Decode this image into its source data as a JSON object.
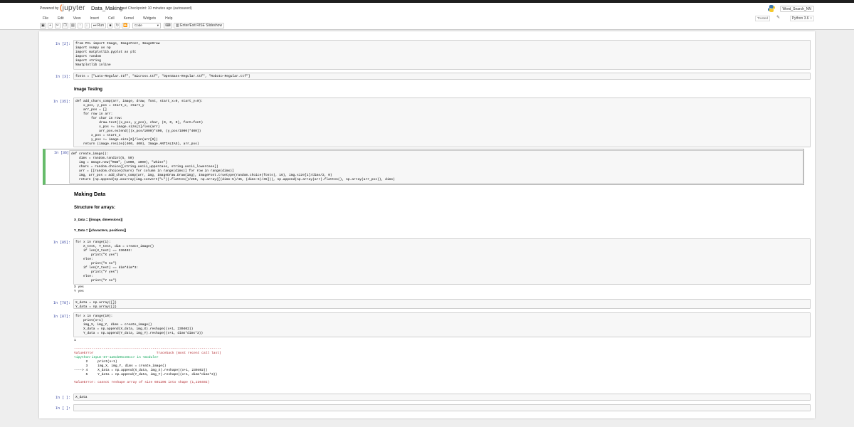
{
  "header": {
    "powered_by": "Powered by",
    "logo_text": "jupyter",
    "notebook_name": "Data_Making",
    "checkpoint": "Last Checkpoint: 10 minutes ago  (autosaved)",
    "user_button": "Word_Search_NN",
    "trusted": "Trusted",
    "kernel": "Python 3.6",
    "menu": [
      "File",
      "Edit",
      "View",
      "Insert",
      "Cell",
      "Kernel",
      "Widgets",
      "Help"
    ],
    "toolbar": {
      "save_icon": "floppy-disk-icon",
      "run_label": "Run",
      "cell_type": "Code",
      "rise_label": "Enter/Exit RISE Slideshow"
    }
  },
  "cells": {
    "c1": {
      "prompt": "In [2]:",
      "code": "from PIL import Image, ImageFont, ImageDraw\nimport numpy as np\nimport matplotlib.pyplot as plt\nimport random\nimport string\n%matplotlib inline"
    },
    "c2": {
      "prompt": "In [3]:",
      "code": "fonts = [\"Lato-Regular.ttf\", \"micross.ttf\", \"OpenSans-Regular.ttf\", \"Roboto-Regular.ttf\"]"
    },
    "md1": "Image Testing",
    "c3": {
      "prompt": "In [35]:",
      "code": "def add_chars_comp(arr, image, draw, font, start_x=0, start_y=0):\n    x_pos, y_pos = start_x, start_y\n    arr_pos = []\n    for row in arr:\n        for char in row:\n            draw.text((x_pos, y_pos), char, (0, 0, 0), font=font)\n            x_pos += image.size[1]/len(arr)\n            arr_pos.extend([(x_pos/1000)*400, (y_pos/1000)*400])\n        x_pos = start_x\n        y_pos += image.size[0]/len(arr[0])\n    return (image.resize((400, 400), Image.ANTIALIAS), arr_pos)"
    },
    "c4": {
      "prompt": "In [36]:",
      "code": "def create_image():\n    dims = random.randint(5, 50)\n    img = Image.new(\"RGB\", (1000, 1000), \"white\")\n    chars = random.choice([string.ascii_uppercase, string.ascii_lowercase])\n    arr = [[random.choice(chars) for column in range(dims)] for row in range(dims)]\n    img, arr_pos = add_chars_comp(arr, img, ImageDraw.Draw(img), ImageFont.truetype(random.choice(fonts), 16), img.size[1]/dims/2, 0)\n    return (np.append(np.asarray(img.convert(\"L\")).flatten()/255, np.array([(dims-5)/45, (dims-5)/45])), np.append(np.array(arr).flatten(), np.array(arr_pos)), dims)"
    },
    "md2": "Making Data",
    "md3": "Structure for arrays:",
    "md4": "X_Data = [[image, dimensions]]",
    "md5": "Y_Data = [[characters, positions]]",
    "c5": {
      "prompt": "In [85]:",
      "code": "for x in range(1):\n    X_test, Y_test, dim = create_image()\n    if len(X_test) == 230402:\n        print(\"X yes\")\n    else:\n        print(\"X no\")\n    if len(Y_test) == dim*dim*3:\n        print(\"Y yes\")\n    else:\n        print(\"Y no\")",
      "output": "X yes\nY yes"
    },
    "c6": {
      "prompt": "In [78]:",
      "code": "X_data = np.array([])\nY_data = np.array([])"
    },
    "c7": {
      "prompt": "In [87]:",
      "code": "for x in range(10):\n    print(x+1)\n    img_X, img_Y, dims = create_image()\n    X_data = np.append(X_data, img_X).reshape((x+1, 230402))\n    Y_data = np.append(Y_data, img_Y).reshape((x+1, dims*dims*3))",
      "output_num": "1",
      "tb_sep": "---------------------------------------------------------------------------",
      "tb_head": "ValueError                                Traceback (most recent call last)",
      "tb_loc": "<ipython-input-87-1a6cb05ce8cc> in <module>",
      "tb_lines": "      2     print(x+1)\n      3     img_X, img_Y, dims = create_image()\n----> 4     X_data = np.append(X_data, img_X).reshape((x+1, 230402))\n      5     Y_data = np.append(Y_data, img_Y).reshape((x+1, dims*dims*3))",
      "tb_err": "ValueError: cannot reshape array of size 691206 into shape (1,230402)"
    },
    "c8": {
      "prompt": "In [ ]:",
      "code": "X_data"
    },
    "c9": {
      "prompt": "In [ ]:",
      "code": ""
    }
  },
  "colors": {
    "selected_border": "#66bb6a",
    "prompt": "#303f9f",
    "error": "#b22b31",
    "logo_accent": "#f37726"
  }
}
